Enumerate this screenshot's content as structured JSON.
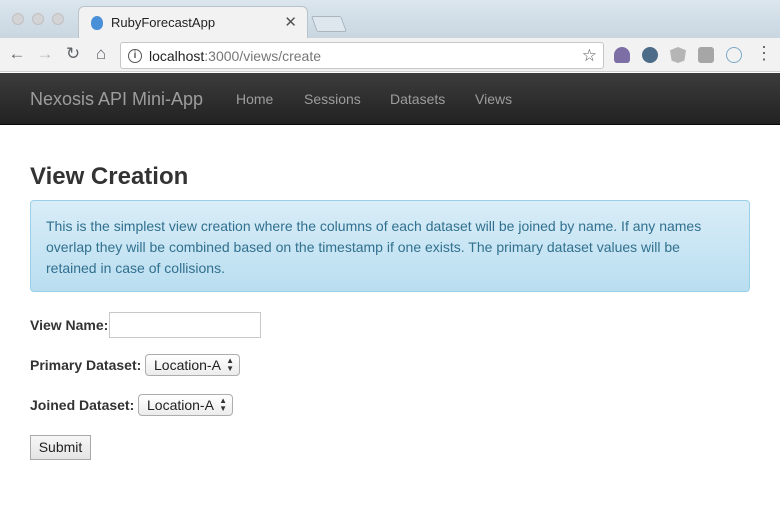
{
  "browser": {
    "tab_title": "RubyForecastApp",
    "url_host": "localhost",
    "url_rest": ":3000/views/create"
  },
  "navbar": {
    "brand": "Nexosis API Mini-App",
    "links": [
      "Home",
      "Sessions",
      "Datasets",
      "Views"
    ]
  },
  "page": {
    "title": "View Creation",
    "info": "This is the simplest view creation where the columns of each dataset will be joined by name. If any names overlap they will be combined based on the timestamp if one exists. The primary dataset values will be retained in case of collisions."
  },
  "form": {
    "view_name_label": "View Name:",
    "view_name_value": "",
    "primary_label": "Primary Dataset:",
    "primary_selected": "Location-A",
    "joined_label": "Joined Dataset:",
    "joined_selected": "Location-A",
    "submit_label": "Submit"
  },
  "colors": {
    "navbar": "#222222",
    "alert_bg": "#d9edf7",
    "alert_text": "#31708f"
  }
}
